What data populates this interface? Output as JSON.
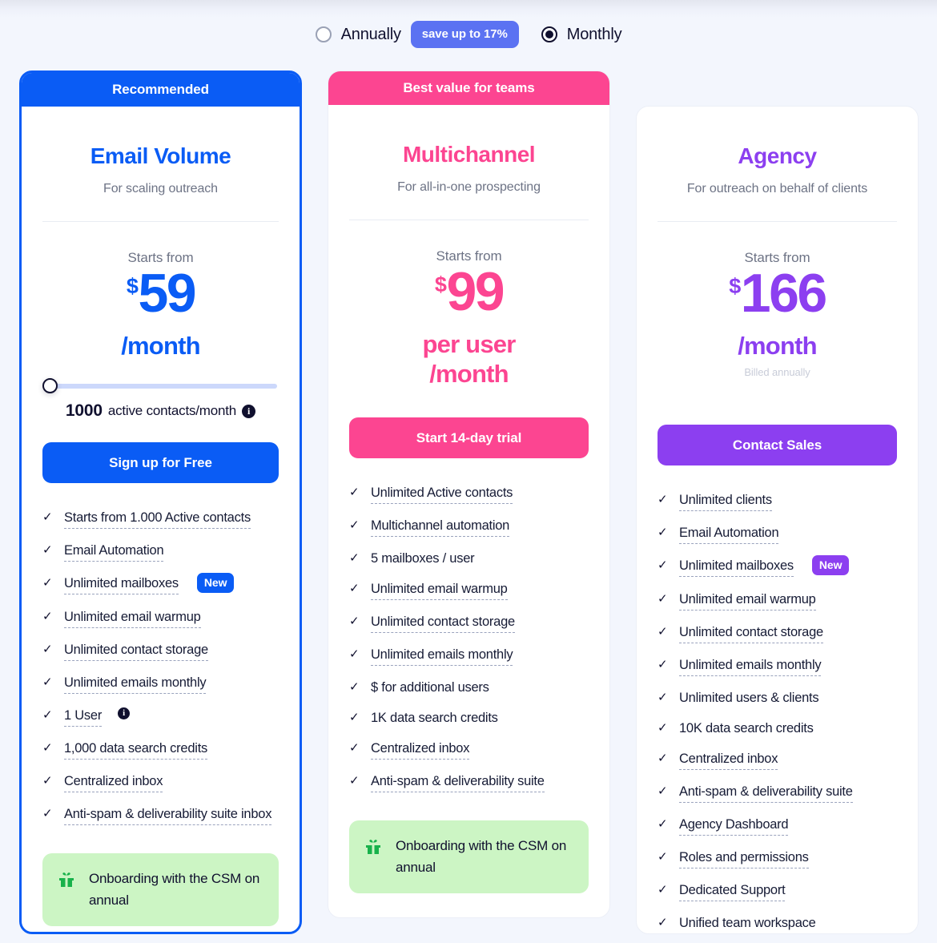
{
  "billing_toggle": {
    "annually": {
      "label": "Annually",
      "selected": false
    },
    "save_badge": "save up to 17%",
    "monthly": {
      "label": "Monthly",
      "selected": true
    }
  },
  "plans": [
    {
      "ribbon": "Recommended",
      "name": "Email Volume",
      "tagline": "For scaling outreach",
      "starts_from": "Starts from",
      "currency": "$",
      "amount": "59",
      "period": "/month",
      "billed_note": "",
      "slider": {
        "quantity": "1000",
        "unit": "active contacts/month",
        "info_icon": "info-icon",
        "value_percent": 0
      },
      "cta": "Sign up for Free",
      "features": [
        {
          "label": "Starts from 1.000 Active contacts",
          "dashed": true
        },
        {
          "label": "Email Automation",
          "dashed": true
        },
        {
          "label": "Unlimited mailboxes",
          "dashed": true,
          "badge": "New"
        },
        {
          "label": "Unlimited email warmup",
          "dashed": true
        },
        {
          "label": "Unlimited contact storage",
          "dashed": true
        },
        {
          "label": "Unlimited emails monthly",
          "dashed": true
        },
        {
          "label": "1 User",
          "dashed": true,
          "info": true
        },
        {
          "label": "1,000 data search credits",
          "dashed": true
        },
        {
          "label": "Centralized inbox",
          "dashed": true
        },
        {
          "label": "Anti-spam & deliverability suite inbox",
          "dashed": true
        }
      ],
      "gift_note": "Onboarding with the CSM on annual"
    },
    {
      "ribbon": "Best value for teams",
      "name": "Multichannel",
      "tagline": "For all-in-one prospecting",
      "starts_from": "Starts from",
      "currency": "$",
      "amount": "99",
      "period": "per user\n/month",
      "billed_note": "",
      "cta": "Start 14-day trial",
      "features": [
        {
          "label": "Unlimited Active contacts",
          "dashed": true
        },
        {
          "label": "Multichannel automation",
          "dashed": true
        },
        {
          "label": "5 mailboxes / user",
          "dashed": false
        },
        {
          "label": "Unlimited email warmup",
          "dashed": true
        },
        {
          "label": "Unlimited contact storage",
          "dashed": true
        },
        {
          "label": "Unlimited emails monthly",
          "dashed": true
        },
        {
          "label": "$ for additional users",
          "dashed": false
        },
        {
          "label": "1K data search credits",
          "dashed": false
        },
        {
          "label": "Centralized inbox",
          "dashed": true
        },
        {
          "label": "Anti-spam & deliverability suite",
          "dashed": true
        }
      ],
      "gift_note": "Onboarding with the CSM on annual"
    },
    {
      "ribbon": "",
      "name": "Agency",
      "tagline": "For outreach on behalf of clients",
      "starts_from": "Starts from",
      "currency": "$",
      "amount": "166",
      "period": "/month",
      "billed_note": "Billed annually",
      "cta": "Contact Sales",
      "features": [
        {
          "label": "Unlimited clients",
          "dashed": true
        },
        {
          "label": "Email Automation",
          "dashed": true
        },
        {
          "label": "Unlimited mailboxes",
          "dashed": true,
          "badge": "New"
        },
        {
          "label": "Unlimited email warmup",
          "dashed": true
        },
        {
          "label": "Unlimited contact storage",
          "dashed": true
        },
        {
          "label": "Unlimited emails monthly",
          "dashed": true
        },
        {
          "label": "Unlimited users & clients",
          "dashed": false
        },
        {
          "label": "10K data search credits",
          "dashed": false
        },
        {
          "label": "Centralized inbox",
          "dashed": true
        },
        {
          "label": "Anti-spam & deliverability suite",
          "dashed": true
        },
        {
          "label": "Agency Dashboard",
          "dashed": true
        },
        {
          "label": "Roles and permissions",
          "dashed": true
        },
        {
          "label": "Dedicated Support",
          "dashed": true
        },
        {
          "label": "Unified team workspace",
          "dashed": true
        }
      ],
      "gift_note": ""
    }
  ],
  "colors": {
    "blue": "#0a5cf5",
    "pink": "#fc4591",
    "purple": "#8c3ff0",
    "periwinkle": "#5b72f2",
    "green_note_bg": "#ccf5c4",
    "ink": "#10102e",
    "page_bg": "#f3f6fd"
  },
  "icons": {
    "check": "✓",
    "info": "i",
    "gift": "gift-icon"
  }
}
